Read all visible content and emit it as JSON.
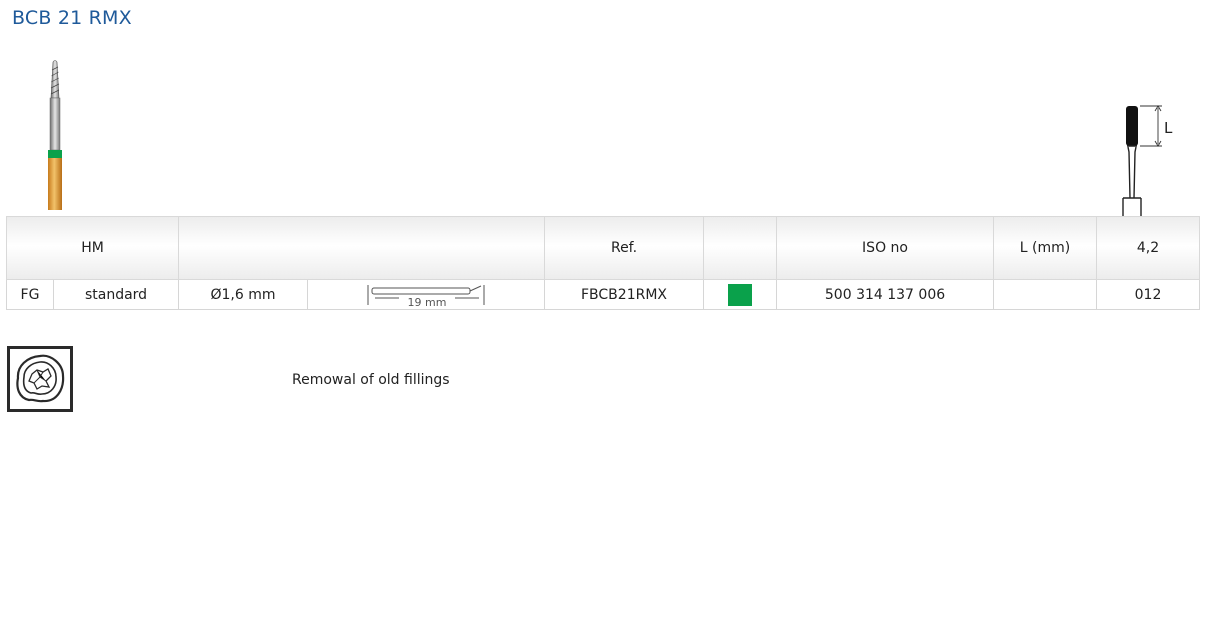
{
  "product": {
    "title": "BCB 21 RMX"
  },
  "profile": {
    "dimension_label": "L"
  },
  "table": {
    "header": {
      "material": "HM",
      "blank": "",
      "ref": "Ref.",
      "color": "",
      "iso": "ISO no",
      "length_label": "L (mm)",
      "length_value": "4,2"
    },
    "row": {
      "shank": "FG",
      "type": "standard",
      "diameter": "Ø1,6 mm",
      "total_length": "19 mm",
      "ref": "FBCB21RMX",
      "color_code": "#0aa14b",
      "iso": "500 314 137 006",
      "size": "012"
    }
  },
  "indication": {
    "icon": "tooth-filling-removal-icon",
    "text": "Remowal of old fillings"
  },
  "colors": {
    "title": "#1f5a9a",
    "band": "#0aa14b",
    "shank": "#e3a23d"
  }
}
